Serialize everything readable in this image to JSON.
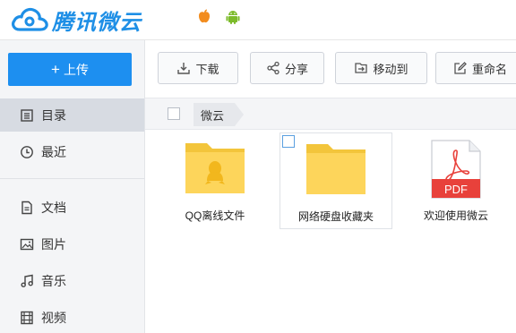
{
  "app": {
    "logo_text": "腾讯微云",
    "platforms": [
      "apple-icon",
      "android-icon"
    ]
  },
  "sidebar": {
    "upload": {
      "plus": "+",
      "label": "上传"
    },
    "items": [
      {
        "label": "目录",
        "icon": "catalog-icon",
        "active": true
      },
      {
        "label": "最近",
        "icon": "clock-icon",
        "active": false
      },
      {
        "label": "文档",
        "icon": "document-icon",
        "active": false
      },
      {
        "label": "图片",
        "icon": "image-icon",
        "active": false
      },
      {
        "label": "音乐",
        "icon": "music-icon",
        "active": false
      },
      {
        "label": "视频",
        "icon": "video-icon",
        "active": false
      }
    ]
  },
  "toolbar": {
    "download": "下载",
    "share": "分享",
    "move": "移动到",
    "rename": "重命名"
  },
  "breadcrumb": {
    "current": "微云"
  },
  "files": [
    {
      "name": "QQ离线文件",
      "type": "folder-qq",
      "selected": false
    },
    {
      "name": "网络硬盘收藏夹",
      "type": "folder",
      "selected": true
    },
    {
      "name": "欢迎使用微云",
      "type": "pdf",
      "badge": "PDF",
      "selected": false
    }
  ],
  "colors": {
    "accent": "#1d8ff0",
    "folder": "#fdd55b",
    "pdf_red": "#e8413b",
    "sidebar_bg": "#f4f5f7"
  }
}
